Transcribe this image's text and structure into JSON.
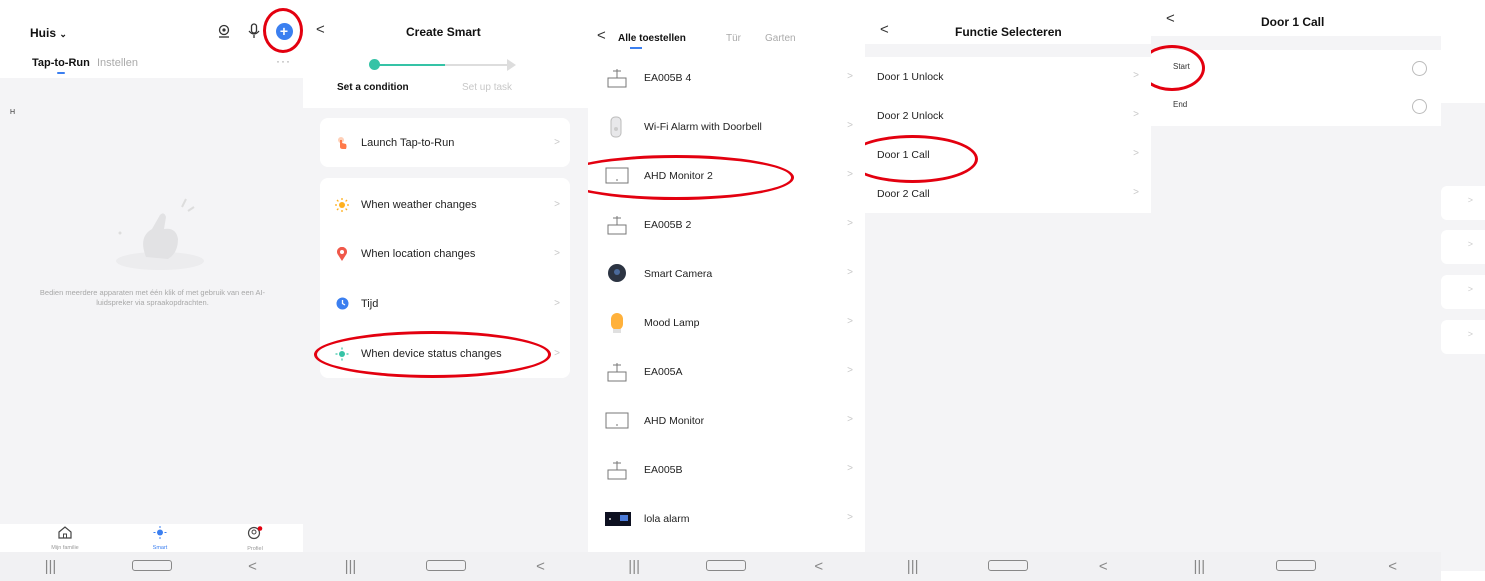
{
  "panel1": {
    "home_title": "Huis",
    "tabs": [
      {
        "label": "Tap-to-Run"
      },
      {
        "label": "Instellen"
      }
    ],
    "more": "···",
    "stray_letter": "H",
    "empty_text": "Bedien meerdere apparaten met één klik of met gebruik van een AI-luidspreker via spraakopdrachten.",
    "tabbar": [
      {
        "label": "Mijn familie",
        "icon": "home-icon"
      },
      {
        "label": "Smart",
        "icon": "smart-sun-icon"
      },
      {
        "label": "Profiel",
        "icon": "profile-icon"
      }
    ]
  },
  "panel2": {
    "title": "Create Smart",
    "steps": [
      "Set a condition",
      "Set up task"
    ],
    "rows": [
      {
        "label": "Launch Tap-to-Run",
        "icon": "tap-hand-icon"
      },
      {
        "label": "When weather changes",
        "icon": "sun-icon"
      },
      {
        "label": "When location changes",
        "icon": "location-pin-icon"
      },
      {
        "label": "Tijd",
        "icon": "clock-icon"
      },
      {
        "label": "When device status changes",
        "icon": "device-status-icon"
      }
    ]
  },
  "panel3": {
    "tabs": [
      {
        "label": "Alle toestellen"
      },
      {
        "label": "Tür"
      },
      {
        "label": "Garten"
      }
    ],
    "devices": [
      {
        "label": "EA005B 4",
        "icon": "gateway-icon"
      },
      {
        "label": "Wi-Fi Alarm with Doorbell",
        "icon": "doorbell-icon"
      },
      {
        "label": "AHD Monitor 2",
        "icon": "monitor-icon"
      },
      {
        "label": "EA005B 2",
        "icon": "gateway-icon"
      },
      {
        "label": "Smart  Camera",
        "icon": "camera-icon"
      },
      {
        "label": "Mood Lamp",
        "icon": "lamp-icon"
      },
      {
        "label": "EA005A",
        "icon": "gateway-icon"
      },
      {
        "label": "AHD Monitor",
        "icon": "monitor-icon"
      },
      {
        "label": "EA005B",
        "icon": "gateway-icon"
      },
      {
        "label": "lola alarm",
        "icon": "alarm-panel-icon"
      }
    ]
  },
  "panel4": {
    "title": "Functie Selecteren",
    "functions": [
      {
        "label": "Door 1 Unlock"
      },
      {
        "label": "Door 2 Unlock"
      },
      {
        "label": "Door 1 Call"
      },
      {
        "label": "Door 2 Call"
      }
    ]
  },
  "panel5": {
    "title": "Door 1 Call",
    "options": [
      {
        "label": "Start"
      },
      {
        "label": "End"
      }
    ]
  },
  "navbar": {
    "recent": "|||",
    "home": "○",
    "back": "<"
  },
  "chevron": ">",
  "back": "<",
  "colors": {
    "accent": "#3b7ff0",
    "annotation": "#e3000f",
    "progress": "#35c3a6"
  }
}
